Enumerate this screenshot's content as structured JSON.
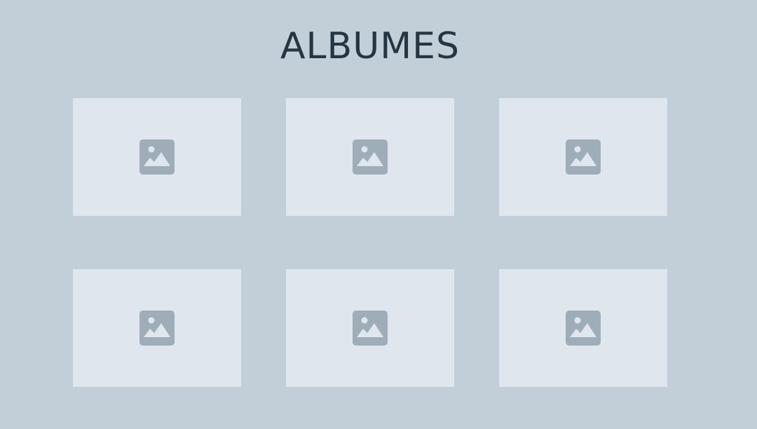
{
  "page": {
    "title": "ALBUMES"
  },
  "albums": [
    {
      "icon": "image-placeholder-icon"
    },
    {
      "icon": "image-placeholder-icon"
    },
    {
      "icon": "image-placeholder-icon"
    },
    {
      "icon": "image-placeholder-icon"
    },
    {
      "icon": "image-placeholder-icon"
    },
    {
      "icon": "image-placeholder-icon"
    }
  ],
  "colors": {
    "background": "#c2cfd8",
    "card": "#dfe6ee",
    "icon": "#9fadb9",
    "title": "#263542"
  }
}
